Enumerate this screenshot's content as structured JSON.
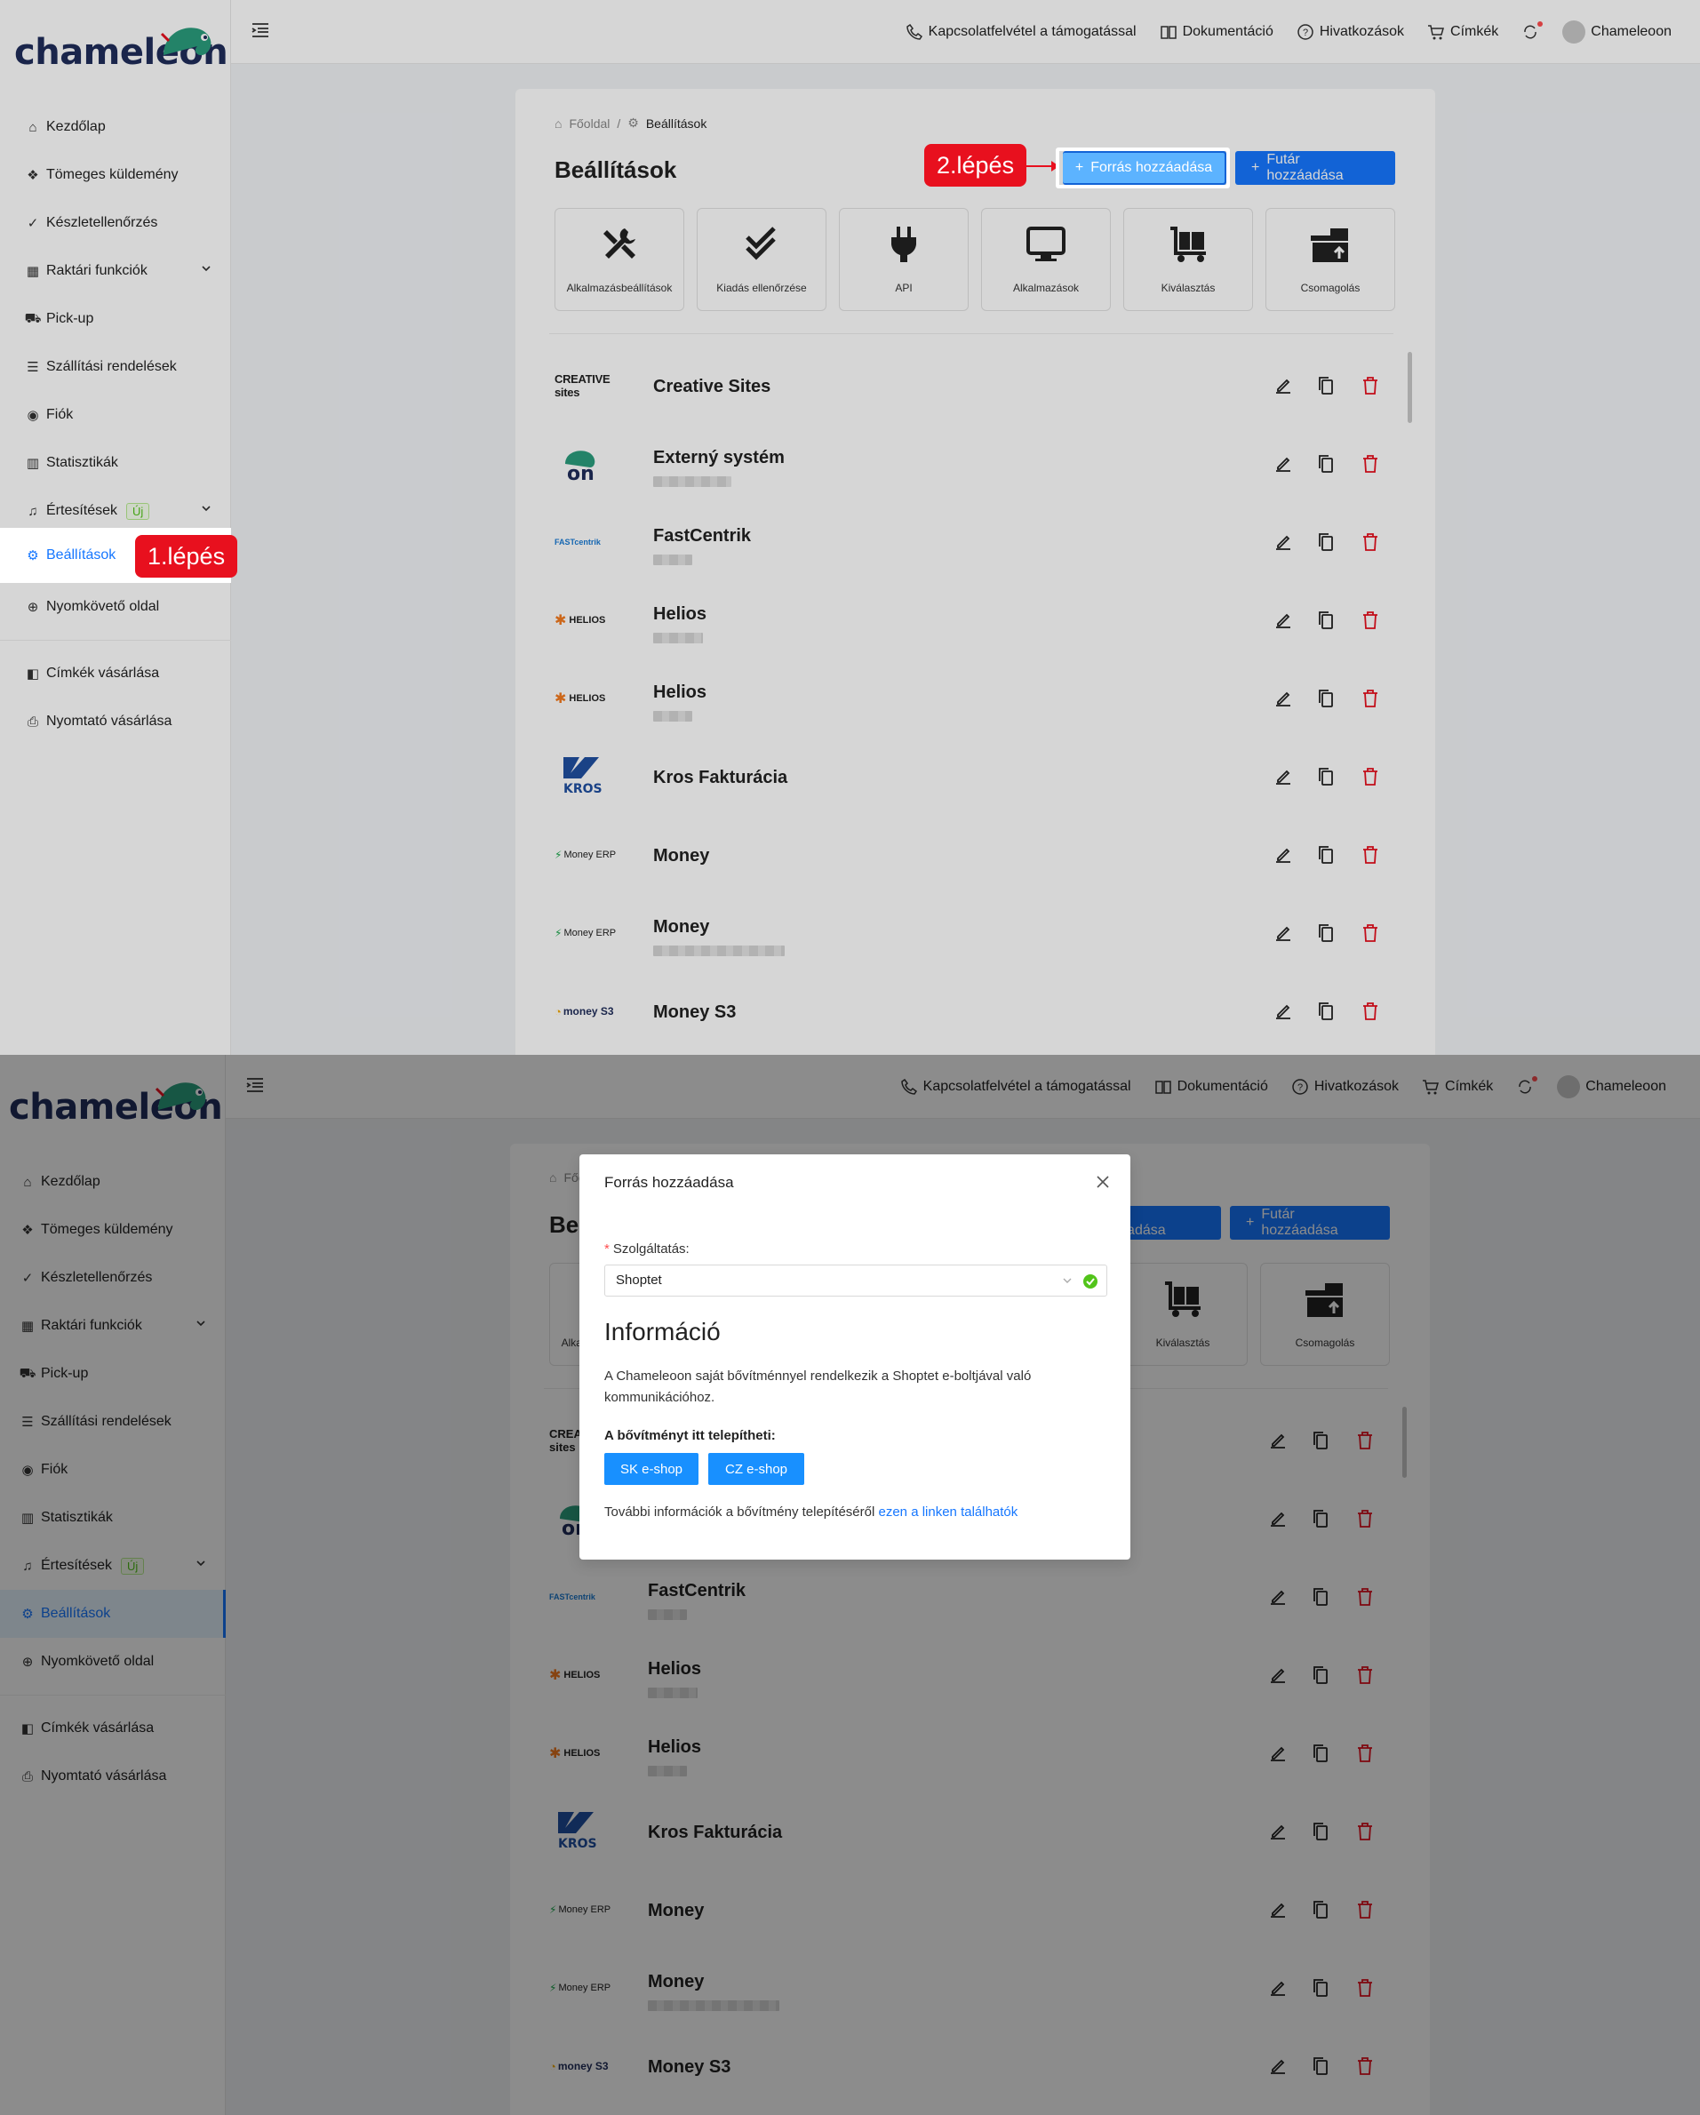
{
  "brand": {
    "name": "chameleon"
  },
  "header": {
    "support": "Kapcsolatfelvétel a támogatással",
    "docs": "Dokumentáció",
    "references": "Hivatkozások",
    "labels": "Címkék",
    "user": "Chameleoon"
  },
  "sidebar": {
    "items": [
      {
        "label": "Kezdőlap",
        "icon": "home-icon"
      },
      {
        "label": "Tömeges küldemény",
        "icon": "boxes-icon"
      },
      {
        "label": "Készletellenőrzés",
        "icon": "double-check-icon"
      },
      {
        "label": "Raktári funkciók",
        "icon": "grid-icon"
      },
      {
        "label": "Pick-up",
        "icon": "truck-icon"
      },
      {
        "label": "Szállítási rendelések",
        "icon": "list-icon"
      },
      {
        "label": "Fiók",
        "icon": "user-circle-icon"
      },
      {
        "label": "Statisztikák",
        "icon": "chart-icon"
      },
      {
        "label": "Értesítések",
        "icon": "bell-icon",
        "badge": "Új"
      },
      {
        "label": "Beállítások",
        "icon": "gear-icon"
      },
      {
        "label": "Nyomkövető oldal",
        "icon": "globe-icon"
      },
      {
        "label": "Címkék vásárlása",
        "icon": "tag-icon"
      },
      {
        "label": "Nyomtató vásárlása",
        "icon": "printer-icon"
      }
    ]
  },
  "breadcrumb": {
    "home": "Főoldal",
    "current": "Beállítások"
  },
  "page": {
    "title": "Beállítások",
    "add_source": "Forrás hozzáadása",
    "add_courier": "Futár hozzáadása"
  },
  "tiles": [
    {
      "label": "Alkalmazásbeállítások",
      "icon": "tools-icon"
    },
    {
      "label": "Kiadás ellenőrzése",
      "icon": "double-check-icon"
    },
    {
      "label": "API",
      "icon": "plug-icon"
    },
    {
      "label": "Alkalmazások",
      "icon": "monitor-icon"
    },
    {
      "label": "Kiválasztás",
      "icon": "cart-icon"
    },
    {
      "label": "Csomagolás",
      "icon": "package-icon"
    }
  ],
  "sources": [
    {
      "name": "Creative Sites",
      "logo": "CREATIVE sites"
    },
    {
      "name": "Externý systém",
      "logo": "on"
    },
    {
      "name": "FastCentrik",
      "logo": "FASTcentrik"
    },
    {
      "name": "Helios",
      "logo": "HELIOS"
    },
    {
      "name": "Helios",
      "logo": "HELIOS"
    },
    {
      "name": "Kros Fakturácia",
      "logo": "KROS"
    },
    {
      "name": "Money",
      "logo": "Money ERP"
    },
    {
      "name": "Money",
      "logo": "Money ERP"
    },
    {
      "name": "Money S3",
      "logo": "money S3"
    }
  ],
  "steps": {
    "one": "1.lépés",
    "two": "2.lépés"
  },
  "modal": {
    "title": "Forrás hozzáadása",
    "service_label": "Szolgáltatás:",
    "service_value": "Shoptet",
    "heading": "Információ",
    "info": "A Chameleoon saját bővítménnyel rendelkezik a Shoptet e-boltjával való kommunikációhoz.",
    "install_here": "A bővítményt itt telepítheti:",
    "sk_button": "SK e-shop",
    "cz_button": "CZ e-shop",
    "more_info": "További információk a bővítmény telepítéséről",
    "more_link": "ezen a linken találhatók"
  },
  "colors": {
    "primary": "#1677ff",
    "danger": "#e8101e",
    "brand": "#1f2d5a",
    "chameleon": "#2a9d7c"
  }
}
